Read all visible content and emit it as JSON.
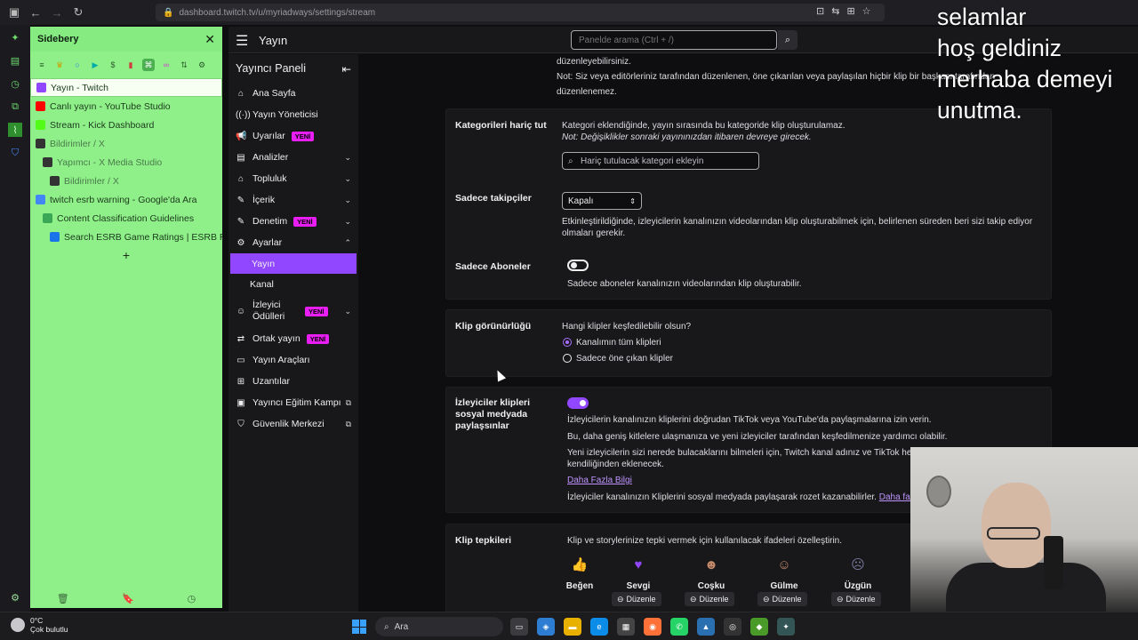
{
  "browser": {
    "url_host": "dashboard.twitch.tv",
    "url_path": "/u/myriadways/settings/stream"
  },
  "overlay_text": [
    "selamlar",
    "hoş geldiniz",
    "merhaba demeyi",
    "unutma."
  ],
  "sidebery": {
    "title": "Sidebery",
    "tabs": [
      {
        "label": "Yayın - Twitch",
        "favicon_color": "#9147ff",
        "indent": 0,
        "active": true
      },
      {
        "label": "Canlı yayın - YouTube Studio",
        "favicon_color": "#ff0000",
        "indent": 0,
        "active": false
      },
      {
        "label": "Stream - Kick Dashboard",
        "favicon_color": "#53fc18",
        "indent": 0,
        "active": false
      },
      {
        "label": "Bildirimler / X",
        "favicon_color": "#333333",
        "indent": 0,
        "active": false,
        "dim": true
      },
      {
        "label": "Yapımcı - X Media Studio",
        "favicon_color": "#333333",
        "indent": 1,
        "active": false,
        "dim": true
      },
      {
        "label": "Bildirimler / X",
        "favicon_color": "#333333",
        "indent": 2,
        "active": false,
        "dim": true
      },
      {
        "label": "twitch esrb warning - Google'da Ara",
        "favicon_color": "#4285f4",
        "indent": 0,
        "active": false
      },
      {
        "label": "Content Classification Guidelines",
        "favicon_color": "#3aa757",
        "indent": 1,
        "active": false
      },
      {
        "label": "Search ESRB Game Ratings | ESRB Ratings",
        "favicon_color": "#1a73e8",
        "indent": 2,
        "active": false
      }
    ]
  },
  "twitch": {
    "header_title": "Yayın",
    "search_placeholder": "Panelde arama (Ctrl + /)",
    "nav": {
      "heading": "Yayıncı Paneli",
      "items": [
        {
          "icon": "home-icon",
          "glyph": "⌂",
          "label": "Ana Sayfa"
        },
        {
          "icon": "stream-manager-icon",
          "glyph": "((·))",
          "label": "Yayın Yöneticisi"
        },
        {
          "icon": "alerts-icon",
          "glyph": "📢",
          "label": "Uyarılar",
          "badge": "YENİ"
        },
        {
          "icon": "analytics-icon",
          "glyph": "▤",
          "label": "Analizler",
          "chevron": "down"
        },
        {
          "icon": "community-icon",
          "glyph": "⌂",
          "label": "Topluluk",
          "chevron": "down"
        },
        {
          "icon": "content-icon",
          "glyph": "✎",
          "label": "İçerik",
          "chevron": "down"
        },
        {
          "icon": "moderation-icon",
          "glyph": "✎",
          "label": "Denetim",
          "badge": "YENİ",
          "chevron": "down"
        },
        {
          "icon": "settings-icon",
          "glyph": "⚙",
          "label": "Ayarlar",
          "chevron": "up"
        }
      ],
      "settings_sub": [
        {
          "label": "Yayın",
          "active": true
        },
        {
          "label": "Kanal",
          "active": false
        }
      ],
      "items_after": [
        {
          "icon": "viewer-rewards-icon",
          "glyph": "☺",
          "label": "İzleyici Ödülleri",
          "badge": "YENİ",
          "chevron": "down"
        },
        {
          "icon": "collab-stream-icon",
          "glyph": "⇄",
          "label": "Ortak yayın",
          "badge": "YENİ"
        },
        {
          "icon": "stream-tools-icon",
          "glyph": "▭",
          "label": "Yayın Araçları"
        },
        {
          "icon": "extensions-icon",
          "glyph": "⊞",
          "label": "Uzantılar"
        },
        {
          "icon": "creator-camp-icon",
          "glyph": "▣",
          "label": "Yayıncı Eğitim Kampı",
          "external": true
        },
        {
          "icon": "safety-center-icon",
          "glyph": "⛉",
          "label": "Güvenlik Merkezi",
          "external": true
        }
      ]
    },
    "main": {
      "top_line_1": "düzenleyebilirsiniz.",
      "top_line_2": "Not: Siz veya editörleriniz tarafından düzenlenen, öne çıkarılan veya paylaşılan hiçbir klip bir başkası tarafından düzenlenemez.",
      "exclude_categories": {
        "label": "Kategorileri hariç tut",
        "desc": "Kategori eklendiğinde, yayın sırasında bu kategoride klip oluşturulamaz.",
        "note": "Not: Değişiklikler sonraki yayınınızdan itibaren devreye girecek.",
        "input_placeholder": "Hariç tutulacak kategori ekleyin"
      },
      "followers_only": {
        "label": "Sadece takipçiler",
        "select_value": "Kapalı",
        "desc": "Etkinleştirildiğinde, izleyicilerin kanalınızın videolarından klip oluşturabilmek için, belirlenen süreden beri sizi takip ediyor olmaları gerekir."
      },
      "subscribers_only": {
        "label": "Sadece Aboneler",
        "desc": "Sadece aboneler kanalınızın videolarından klip oluşturabilir."
      },
      "clip_visibility": {
        "label": "Klip görünürlüğü",
        "question": "Hangi klipler keşfedilebilir olsun?",
        "option_all": "Kanalımın tüm klipleri",
        "option_featured": "Sadece öne çıkan klipler"
      },
      "social_share": {
        "label": "İzleyiciler klipleri sosyal medyada paylaşsınlar",
        "line1": "İzleyicilerin kanalınızın kliplerini doğrudan TikTok veya YouTube'da paylaşmalarına izin verin.",
        "line2": "Bu, daha geniş kitlelere ulaşmanıza ve yeni izleyiciler tarafından keşfedilmenize yardımcı olabilir.",
        "line3": "Yeni izleyicilerin sizi nerede bulacaklarını bilmeleri için, Twitch kanal adınız ve TikTok hes",
        "line4": "kendiliğinden eklenecek.",
        "learn_more": "Daha Fazla Bilgi",
        "line5": "İzleyiciler kanalınızın Kliplerini sosyal medyada paylaşarak rozet kazanabilirler.",
        "line5_link": "Daha fazl"
      },
      "clip_reactions": {
        "label": "Klip tepkileri",
        "desc": "Klip ve storylerinize tepki vermek için kullanılacak ifadeleri özelleştirin.",
        "emotes": [
          {
            "name": "Beğen",
            "glyph": "👍",
            "color": "#efeff1"
          },
          {
            "name": "Sevgi",
            "glyph": "♥",
            "color": "#9147ff"
          },
          {
            "name": "Coşku",
            "glyph": "☻",
            "color": "#c58a6a"
          },
          {
            "name": "Gülme",
            "glyph": "☺",
            "color": "#c58a6a"
          },
          {
            "name": "Üzgün",
            "glyph": "☹",
            "color": "#7a7aa0"
          }
        ],
        "edit_label": "Düzenle"
      }
    }
  },
  "taskbar": {
    "temperature": "0°C",
    "weather_desc": "Çok bulutlu",
    "search_label": "Ara"
  }
}
